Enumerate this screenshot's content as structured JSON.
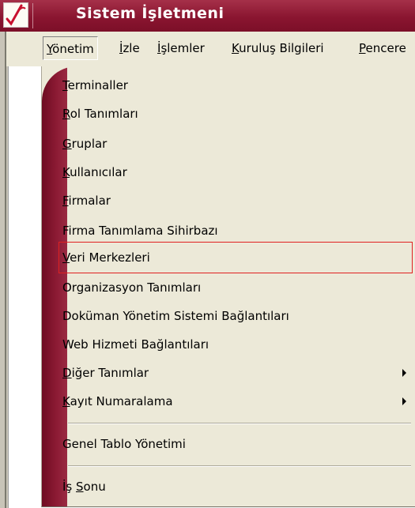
{
  "window": {
    "title": "Sistem İşletmeni",
    "icon": "app-logo-icon"
  },
  "menubar": [
    {
      "pre": "",
      "u": "Y",
      "post": "önetim"
    },
    {
      "pre": "",
      "u": "İ",
      "post": "zle"
    },
    {
      "pre": "",
      "u": "İ",
      "post": "şlemler"
    },
    {
      "pre": "",
      "u": "K",
      "post": "uruluş Bilgileri"
    },
    {
      "pre": "",
      "u": "P",
      "post": "encere"
    }
  ],
  "menu": {
    "items": [
      {
        "pre": "",
        "u": "T",
        "post": "erminaller"
      },
      {
        "pre": "",
        "u": "R",
        "post": "ol Tanımları"
      },
      {
        "pre": "",
        "u": "G",
        "post": "ruplar"
      },
      {
        "pre": "",
        "u": "K",
        "post": "ullanıcılar"
      },
      {
        "pre": "",
        "u": "F",
        "post": "irmalar"
      },
      {
        "pre": "Firma Tanımlama Sihirbazı",
        "u": "",
        "post": ""
      },
      {
        "pre": "",
        "u": "V",
        "post": "eri Merkezleri"
      },
      {
        "pre": "Organizasyon Tanımları",
        "u": "",
        "post": ""
      },
      {
        "pre": "Doküman Yönetim Sistemi Bağlantıları",
        "u": "",
        "post": ""
      },
      {
        "pre": "Web Hizmeti Bağlantıları",
        "u": "",
        "post": ""
      },
      {
        "pre": "",
        "u": "D",
        "post": "iğer Tanımlar"
      },
      {
        "pre": "",
        "u": "K",
        "post": "ayıt Numaralama"
      },
      {
        "pre": "Genel Tablo Yönetimi",
        "u": "",
        "post": ""
      },
      {
        "pre": "İş ",
        "u": "S",
        "post": "onu"
      }
    ]
  },
  "colors": {
    "title_bar": "#8a1530",
    "highlight_border": "#e02020",
    "menu_background": "#ece9d8"
  }
}
